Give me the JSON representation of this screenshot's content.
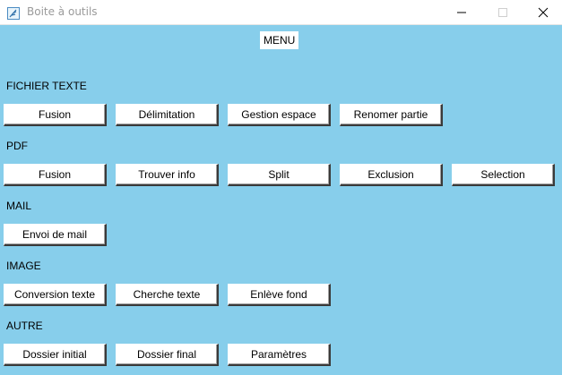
{
  "window": {
    "title": "Boite à outils"
  },
  "menu": {
    "label": "MENU"
  },
  "sections": [
    {
      "label": "FICHIER TEXTE",
      "buttons": [
        "Fusion",
        "Délimitation",
        "Gestion espace",
        "Renomer partie"
      ]
    },
    {
      "label": "PDF",
      "buttons": [
        "Fusion",
        "Trouver info",
        "Split",
        "Exclusion",
        "Selection"
      ]
    },
    {
      "label": "MAIL",
      "buttons": [
        "Envoi de mail"
      ]
    },
    {
      "label": "IMAGE",
      "buttons": [
        "Conversion texte",
        "Cherche texte",
        "Enlève fond"
      ]
    },
    {
      "label": "AUTRE",
      "buttons": [
        "Dossier initial",
        "Dossier final",
        "Paramètres"
      ]
    }
  ],
  "icons": {
    "app": "feather-icon",
    "minimize": "minimize-icon",
    "maximize": "maximize-icon",
    "close": "close-icon"
  },
  "colors": {
    "background": "#87ceeb",
    "button": "#ffffff"
  }
}
